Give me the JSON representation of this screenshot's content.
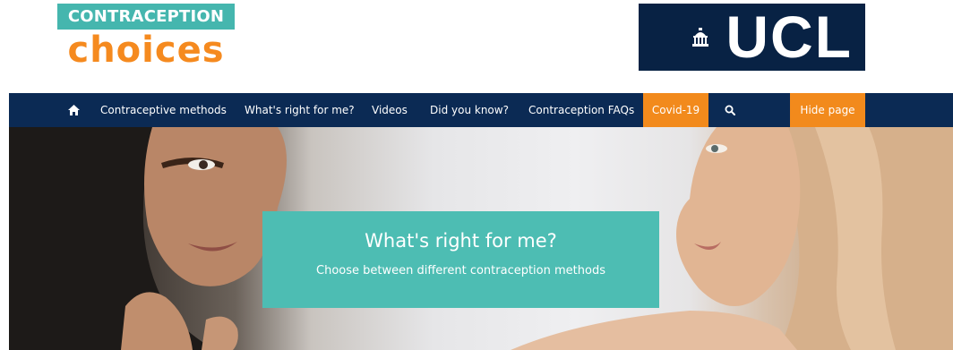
{
  "logo": {
    "top_text": "CONTRACEPTION",
    "bottom_text": "choices"
  },
  "partner_logo": {
    "text": "UCL",
    "icon": "portico-icon"
  },
  "nav": {
    "home_icon": "home-icon",
    "items": [
      {
        "label": "Contraceptive methods"
      },
      {
        "label": "What's right for me?"
      },
      {
        "label": "Videos"
      },
      {
        "label": "Did you know?"
      },
      {
        "label": "Contraception FAQs"
      }
    ],
    "covid_label": "Covid-19",
    "search_icon": "search-icon",
    "hide_label": "Hide page"
  },
  "hero": {
    "title": "What's right for me?",
    "subtitle": "Choose between different contraception methods"
  },
  "colors": {
    "brand_teal": "#45b6ae",
    "brand_orange": "#f58a1f",
    "nav_navy": "#0b2a54",
    "ucl_navy": "#082244",
    "accent_orange": "#f28a1c",
    "banner_teal": "#4dbdb3"
  }
}
